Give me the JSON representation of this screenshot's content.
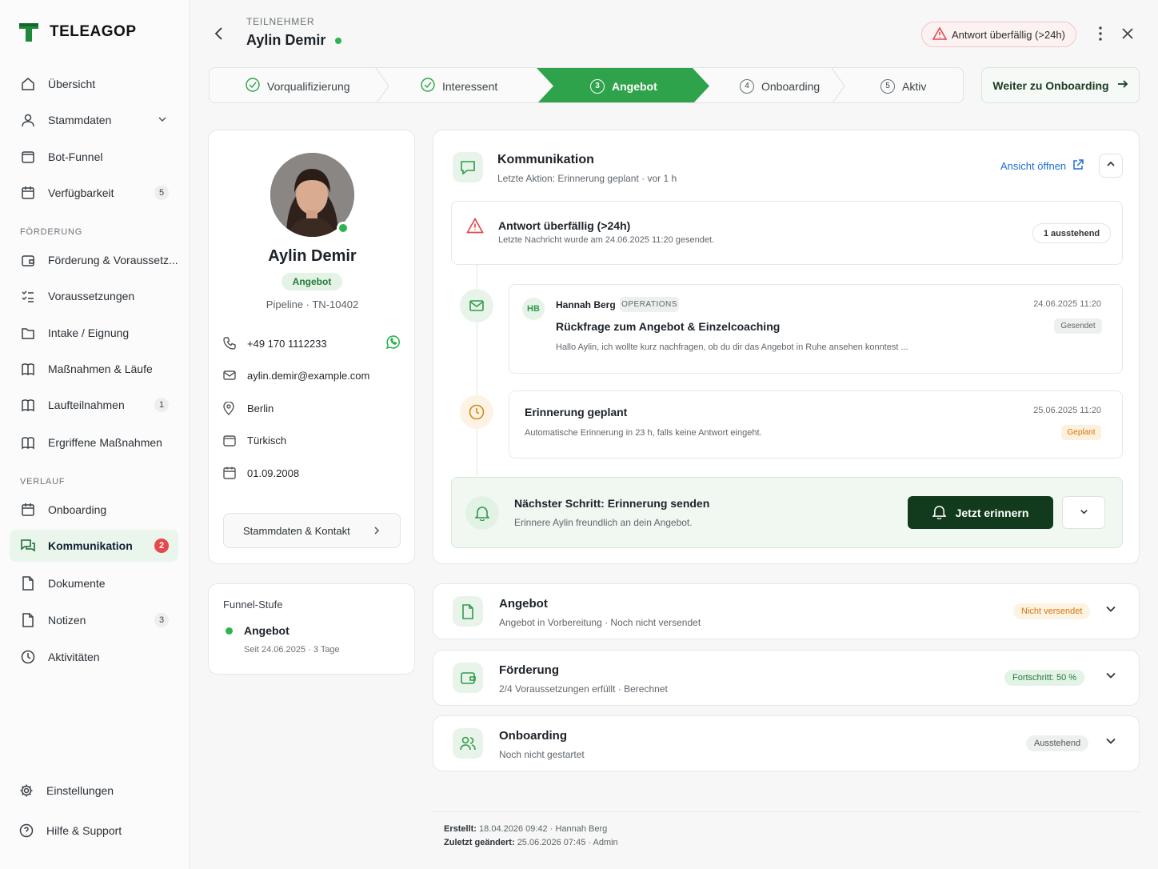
{
  "app": {
    "name": "TELEAGOP"
  },
  "sidebar": {
    "items": [
      {
        "label": "Übersicht"
      },
      {
        "label": "Stammdaten"
      },
      {
        "label": "Bot-Funnel"
      },
      {
        "label": "Verfügbarkeit",
        "badge": "5"
      }
    ],
    "section_foerderung": "FÖRDERUNG",
    "foerderung_items": [
      {
        "label": "Förderung & Voraussetz..."
      },
      {
        "label": "Voraussetzungen"
      },
      {
        "label": "Intake / Eignung"
      },
      {
        "label": "Maßnahmen & Läufe"
      },
      {
        "label": "Laufteilnahmen",
        "badge": "1"
      },
      {
        "label": "Ergriffene Maßnahmen"
      }
    ],
    "section_verlauf": "VERLAUF",
    "verlauf_items": [
      {
        "label": "Onboarding"
      },
      {
        "label": "Kommunikation",
        "badge": "2"
      },
      {
        "label": "Dokumente"
      },
      {
        "label": "Notizen",
        "badge": "3"
      },
      {
        "label": "Aktivitäten"
      }
    ],
    "settings": "Einstellungen",
    "help": "Hilfe & Support"
  },
  "header": {
    "kicker": "TEILNEHMER",
    "name": "Aylin Demir",
    "alert": "Antwort überfällig (>24h)"
  },
  "stepper": {
    "steps": [
      {
        "label": "Vorqualifizierung",
        "state": "done"
      },
      {
        "label": "Interessent",
        "state": "done"
      },
      {
        "num": "3",
        "label": "Angebot",
        "state": "active"
      },
      {
        "num": "4",
        "label": "Onboarding",
        "state": "todo"
      },
      {
        "num": "5",
        "label": "Aktiv",
        "state": "todo"
      }
    ],
    "next_button": "Weiter zu Onboarding"
  },
  "profile": {
    "name": "Aylin Demir",
    "stage_badge": "Angebot",
    "pipeline": "Pipeline · TN-10402",
    "phone": "+49 170 1112233",
    "email": "aylin.demir@example.com",
    "city": "Berlin",
    "language": "Türkisch",
    "birthdate": "01.09.2008",
    "button": "Stammdaten & Kontakt"
  },
  "funnel": {
    "title": "Funnel-Stufe",
    "stage": "Angebot",
    "since": "Seit 24.06.2025 · 3 Tage"
  },
  "communication": {
    "title": "Kommunikation",
    "subtitle": "Letzte Aktion: Erinnerung geplant · vor 1 h",
    "view_link": "Ansicht öffnen",
    "overdue": {
      "title": "Antwort überfällig (>24h)",
      "subtitle": "Letzte Nachricht wurde am 24.06.2025 11:20 gesendet.",
      "pending": "1 ausstehend"
    },
    "message": {
      "initials": "HB",
      "author": "Hannah Berg",
      "role": "OPERATIONS",
      "timestamp": "24.06.2025 11:20",
      "subject": "Rückfrage zum Angebot & Einzelcoaching",
      "status": "Gesendet",
      "preview": "Hallo Aylin, ich wollte kurz nachfragen, ob du dir das Angebot in Ruhe ansehen konntest ..."
    },
    "reminder": {
      "title": "Erinnerung geplant",
      "timestamp": "25.06.2025 11:20",
      "text": "Automatische Erinnerung in 23 h, falls keine Antwort eingeht.",
      "status": "Geplant"
    },
    "next_step": {
      "title": "Nächster Schritt: Erinnerung senden",
      "subtitle": "Erinnere Aylin freundlich an dein Angebot.",
      "button": "Jetzt erinnern"
    }
  },
  "sections": [
    {
      "title": "Angebot",
      "subtitle": "Angebot in Vorbereitung · Noch nicht versendet",
      "status": "Nicht versendet"
    },
    {
      "title": "Förderung",
      "subtitle": "2/4 Voraussetzungen erfüllt · Berechnet",
      "status": "Fortschritt: 50 %"
    },
    {
      "title": "Onboarding",
      "subtitle": "Noch nicht gestartet",
      "status": "Ausstehend"
    }
  ],
  "footer": {
    "created_label": "Erstellt:",
    "created_value": "18.04.2026 09:42 · Hannah Berg",
    "changed_label": "Zuletzt geändert:",
    "changed_value": "25.06.2026 07:45 · Admin"
  },
  "colors": {
    "brand_green": "#2fa24c",
    "dark_green": "#123a1d",
    "alert_red": "#e5484d",
    "link_blue": "#1f6fd1",
    "warning_orange": "#e07a10"
  }
}
